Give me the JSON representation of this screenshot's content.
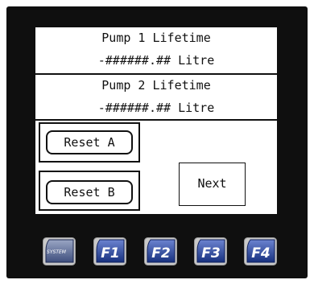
{
  "pump1": {
    "title": "Pump 1 Lifetime",
    "value": "-######.## Litre"
  },
  "pump2": {
    "title": "Pump 2 Lifetime",
    "value": "-######.## Litre"
  },
  "buttons": {
    "reset_a": "Reset A",
    "reset_b": "Reset B",
    "next": "Next"
  },
  "function_keys": [
    {
      "label": "SYSTEM",
      "icon": "system-key-icon"
    },
    {
      "label": "F1",
      "icon": "f1-key-icon"
    },
    {
      "label": "F2",
      "icon": "f2-key-icon"
    },
    {
      "label": "F3",
      "icon": "f3-key-icon"
    },
    {
      "label": "F4",
      "icon": "f4-key-icon"
    }
  ],
  "colors": {
    "bezel": "#0f0f0f",
    "screen": "#ffffff",
    "key_face": "#1e3e9a",
    "key_text": "#ffffff"
  }
}
